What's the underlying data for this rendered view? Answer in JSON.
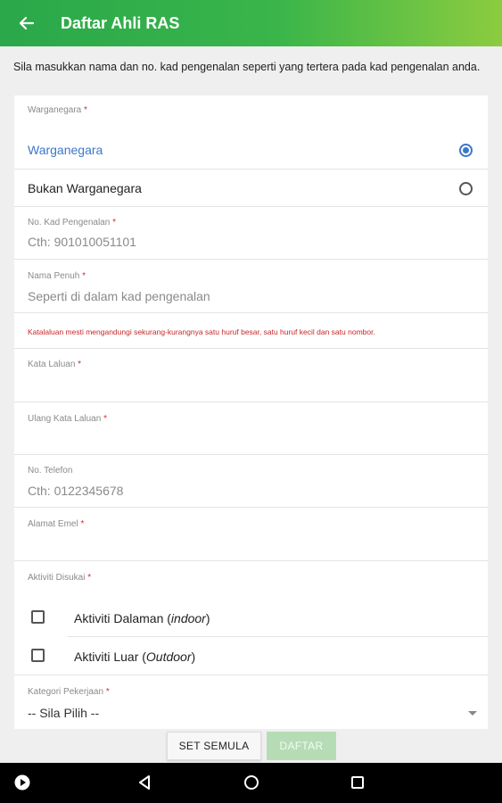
{
  "appbar": {
    "title": "Daftar Ahli RAS",
    "back_icon": "arrow-left-icon"
  },
  "intro": "Sila masukkan nama dan no. kad pengenalan seperti yang tertera pada kad pengenalan anda.",
  "citizenship": {
    "label": "Warganegara",
    "options": [
      {
        "label": "Warganegara",
        "selected": true
      },
      {
        "label": "Bukan Warganegara",
        "selected": false
      }
    ]
  },
  "ic_number": {
    "label": "No. Kad Pengenalan",
    "placeholder": "Cth: 901010051101"
  },
  "full_name": {
    "label": "Nama Penuh",
    "placeholder": "Seperti di dalam kad pengenalan"
  },
  "password_hint": "Katalaluan mesti mengandungi sekurang-kurangnya satu huruf besar, satu huruf kecil dan satu nombor.",
  "password": {
    "label": "Kata Laluan",
    "value": ""
  },
  "password_repeat": {
    "label": "Ulang Kata Laluan",
    "value": ""
  },
  "phone": {
    "label": "No. Telefon",
    "placeholder": "Cth: 0122345678"
  },
  "email": {
    "label": "Alamat Emel",
    "value": ""
  },
  "activities": {
    "label": "Aktiviti Disukai",
    "options": [
      {
        "text": "Aktiviti Dalaman (",
        "italic": "indoor",
        "close": ")",
        "checked": false
      },
      {
        "text": "Aktiviti Luar (",
        "italic": "Outdoor",
        "close": ")",
        "checked": false
      }
    ]
  },
  "job_category": {
    "label": "Kategori Pekerjaan",
    "value": "-- Sila Pilih --"
  },
  "buttons": {
    "reset": "SET SEMULA",
    "submit": "DAFTAR"
  },
  "colors": {
    "appbar_start": "#2aa84a",
    "appbar_end": "#8ccc3f",
    "accent": "#3c77c9",
    "required": "#d32f2f"
  }
}
